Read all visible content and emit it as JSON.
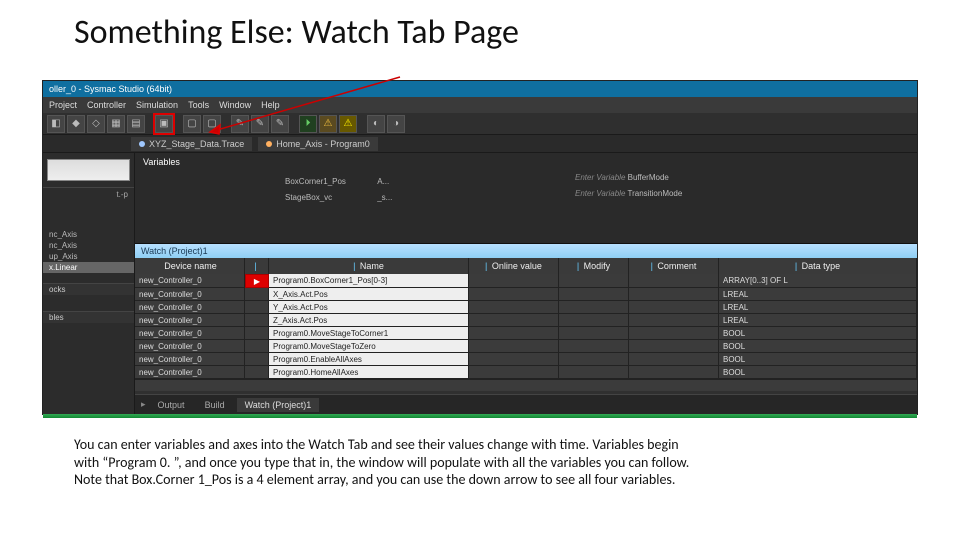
{
  "slide": {
    "title": "Something Else: Watch Tab Page",
    "caption_l1": "You can enter variables and axes into the Watch Tab and see their values change with time. Variables begin",
    "caption_l2": "with “Program 0. ”, and once you type that in, the window will populate with all the variables you can follow.",
    "caption_l3": "Note that Box.Corner 1_Pos is a 4 element array, and you can use the down arrow to see all four variables."
  },
  "ide": {
    "titlebar": "oller_0 - Sysmac Studio (64bit)",
    "menu": [
      "Project",
      "Controller",
      "Simulation",
      "Tools",
      "Window",
      "Help"
    ],
    "doctabs": [
      {
        "icon": "trace",
        "label": "XYZ_Stage_Data.Trace"
      },
      {
        "icon": "prog",
        "label": "Home_Axis - Program0"
      }
    ],
    "variables_header": "Variables",
    "var_rows": [
      {
        "name": "BoxCorner1_Pos",
        "val": "A..."
      },
      {
        "name": "StageBox_vc",
        "val": "_s..."
      }
    ],
    "enter_rows": [
      {
        "prompt": "Enter Variable",
        "value": "BufferMode"
      },
      {
        "prompt": "Enter Variable",
        "value": "TransitionMode"
      }
    ],
    "side_top_label": "t.-p",
    "side_sections": [
      {
        "items": [
          "nc_Axis",
          "nc_Axis",
          "up_Axis"
        ],
        "selected": "x.Linear"
      },
      {
        "title": "ocks",
        "items": []
      },
      {
        "title": "bles",
        "items": []
      }
    ],
    "pin_icon": "▼ × ↑"
  },
  "watch": {
    "title": "Watch (Project)1",
    "columns": [
      "Device name",
      "",
      "Name",
      "Online value",
      "Modify",
      "Comment",
      "Data type"
    ],
    "rows": [
      {
        "dev": "new_Controller_0",
        "expand": true,
        "name": "Program0.BoxCorner1_Pos[0-3]",
        "type": "ARRAY[0..3] OF L"
      },
      {
        "dev": "new_Controller_0",
        "name": "X_Axis.Act.Pos",
        "type": "LREAL"
      },
      {
        "dev": "new_Controller_0",
        "name": "Y_Axis.Act.Pos",
        "type": "LREAL"
      },
      {
        "dev": "new_Controller_0",
        "name": "Z_Axis.Act.Pos",
        "type": "LREAL"
      },
      {
        "dev": "new_Controller_0",
        "name": "Program0.MoveStageToCorner1",
        "type": "BOOL"
      },
      {
        "dev": "new_Controller_0",
        "name": "Program0.MoveStageToZero",
        "type": "BOOL"
      },
      {
        "dev": "new_Controller_0",
        "name": "Program0.EnableAllAxes",
        "type": "BOOL"
      },
      {
        "dev": "new_Controller_0",
        "name": "Program0.HomeAllAxes",
        "type": "BOOL"
      }
    ],
    "bottom_tabs": [
      "Output",
      "Build",
      "Watch (Project)1"
    ],
    "active_tab": 2
  }
}
